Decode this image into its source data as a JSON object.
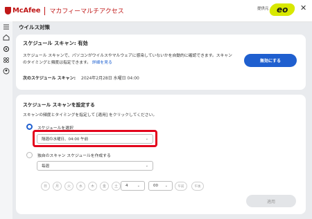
{
  "app": {
    "brand": "McAfee",
    "product": "マカフィーマルチアクセス",
    "partner_text": "提供元",
    "partner_logo_text": "eo"
  },
  "sidebar": {
    "icons": [
      "menu-icon",
      "home-icon",
      "security-icon",
      "apps-icon",
      "account-icon"
    ]
  },
  "page": {
    "title": "ウイルス対策"
  },
  "status_card": {
    "title": "スケジュール スキャン: 有効",
    "description": "スケジュール スキャンで、パソコンがウイルスやマルウェアに感染していないかを自動的に確認できます。スキャンのタイミングと頻度は指定できます。",
    "details_link": "詳細を見る",
    "next_scan_label": "次のスケジュール スキャン:",
    "next_scan_value": "2024年2月28日 水曜日 04:00",
    "disable_button": "無効にする"
  },
  "settings_card": {
    "title": "スケジュール スキャンを設定する",
    "description": "スキャンの頻度とタイミングを指定して [適用] をクリックしてください。",
    "option_preset_label": "スケジュールを選択",
    "option_preset_selected": true,
    "preset_value": "隔週の水曜日、04:00 午前",
    "option_custom_label": "独自のスキャン スケジュールを作成する",
    "frequency_value": "毎週",
    "days": [
      "日",
      "月",
      "火",
      "水",
      "木",
      "金",
      "土"
    ],
    "hour_value": "4",
    "minute_value": "00",
    "am_label": "午前",
    "pm_label": "午後",
    "apply_button": "適用"
  },
  "colors": {
    "accent": "#1f5fcf",
    "brand_red": "#c01818",
    "highlight_red": "#e3001b"
  }
}
